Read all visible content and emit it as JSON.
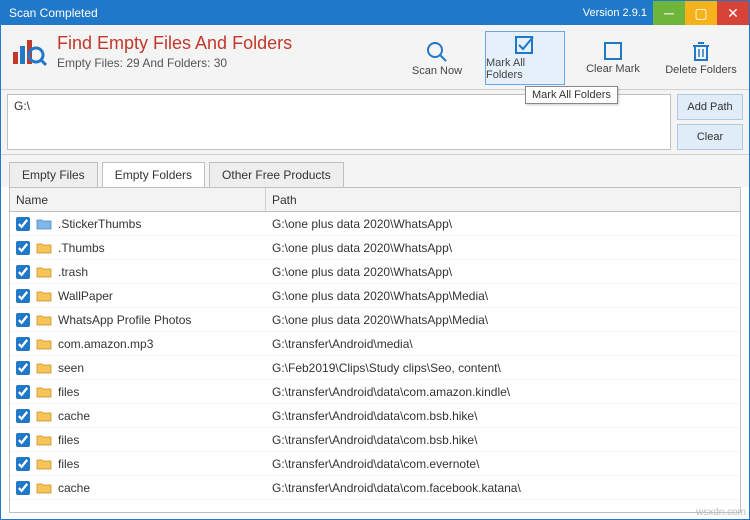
{
  "window": {
    "title": "Scan Completed",
    "version": "Version 2.9.1"
  },
  "header": {
    "title": "Find Empty Files And Folders",
    "subtitle": "Empty Files: 29 And Folders: 30"
  },
  "toolbar": {
    "scan_now": "Scan Now",
    "mark_all_folders": "Mark All Folders",
    "clear_mark": "Clear Mark",
    "delete_folders": "Delete Folders",
    "tooltip_mark_all": "Mark All Folders"
  },
  "path": {
    "value": "G:\\"
  },
  "side": {
    "add_path": "Add Path",
    "clear": "Clear"
  },
  "tabs": {
    "empty_files": "Empty Files",
    "empty_folders": "Empty Folders",
    "other_products": "Other Free Products"
  },
  "columns": {
    "name": "Name",
    "path": "Path"
  },
  "rows": [
    {
      "name": ".StickerThumbs",
      "path": "G:\\one plus data 2020\\WhatsApp\\",
      "blue": true
    },
    {
      "name": ".Thumbs",
      "path": "G:\\one plus data 2020\\WhatsApp\\"
    },
    {
      "name": ".trash",
      "path": "G:\\one plus data 2020\\WhatsApp\\"
    },
    {
      "name": "WallPaper",
      "path": "G:\\one plus data 2020\\WhatsApp\\Media\\"
    },
    {
      "name": "WhatsApp Profile Photos",
      "path": "G:\\one plus data 2020\\WhatsApp\\Media\\"
    },
    {
      "name": "com.amazon.mp3",
      "path": "G:\\transfer\\Android\\media\\"
    },
    {
      "name": "seen",
      "path": "G:\\Feb2019\\Clips\\Study clips\\Seo, content\\"
    },
    {
      "name": "files",
      "path": "G:\\transfer\\Android\\data\\com.amazon.kindle\\"
    },
    {
      "name": "cache",
      "path": "G:\\transfer\\Android\\data\\com.bsb.hike\\"
    },
    {
      "name": "files",
      "path": "G:\\transfer\\Android\\data\\com.bsb.hike\\"
    },
    {
      "name": "files",
      "path": "G:\\transfer\\Android\\data\\com.evernote\\"
    },
    {
      "name": "cache",
      "path": "G:\\transfer\\Android\\data\\com.facebook.katana\\"
    }
  ],
  "watermark": "wsxdn.com"
}
